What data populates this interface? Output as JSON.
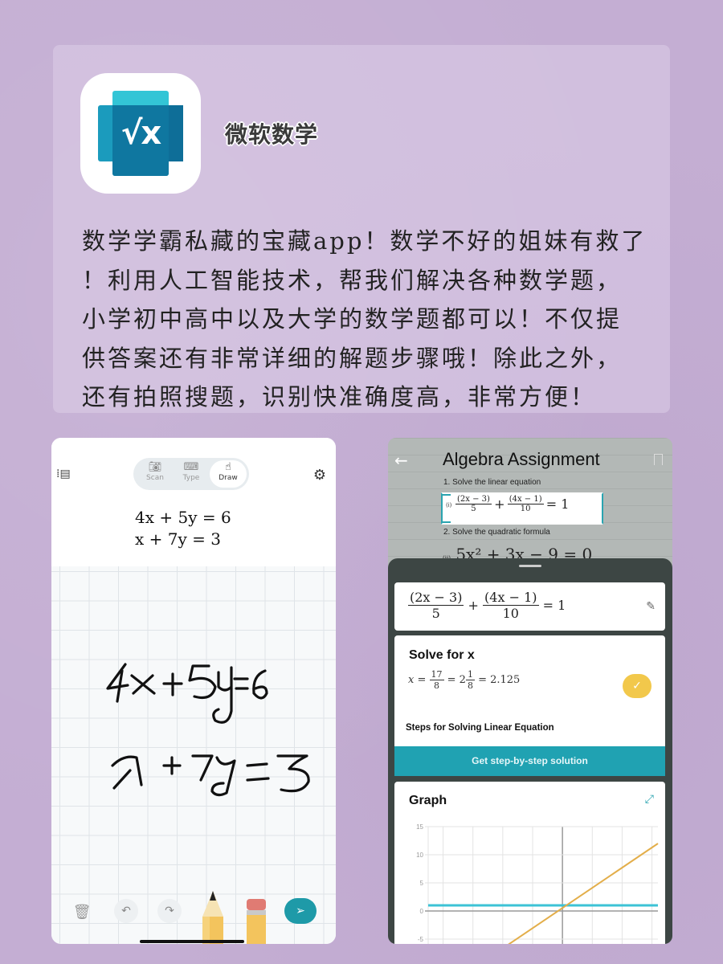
{
  "header": {
    "app_icon_glyph": "√x",
    "app_name": "微软数学",
    "description_lines": [
      "数学学霸私藏的宝藏app！数学不好的姐妹有救了",
      "！利用人工智能技术，帮我们解决各种数学题，",
      "小学初中高中以及大学的数学题都可以！不仅提",
      "供答案还有非常详细的解题步骤哦！除此之外，",
      "还有拍照搜题，识别快准确度高，非常方便！"
    ]
  },
  "left_phone": {
    "menu_icon": "list-icon",
    "settings_icon": "gear-icon",
    "modes": [
      {
        "label": "Scan",
        "icon": "camera-icon",
        "active": false
      },
      {
        "label": "Type",
        "icon": "keyboard-icon",
        "active": false
      },
      {
        "label": "Draw",
        "icon": "hand-draw-icon",
        "active": true
      }
    ],
    "typed_equations": [
      "4x + 5y = 6",
      "x + 7y = 3"
    ],
    "handwritten_equations": [
      "4x+5y=6",
      "x+7y=3"
    ],
    "toolbar": {
      "trash_icon": "trash-icon",
      "undo_icon": "undo-icon",
      "redo_icon": "redo-icon",
      "pencil_tool": "pencil-icon",
      "eraser_tool": "eraser-icon",
      "send_icon": "send-icon"
    }
  },
  "right_phone": {
    "back_icon": "back-arrow-icon",
    "bookmark_icon": "bookmark-icon",
    "paper_title": "Algebra Assignment",
    "question1": "1. Solve the linear equation",
    "question1_label": "(i)",
    "question2": "2. Solve the quadratic formula",
    "question2_label": "(ii)",
    "question2_equation": "5x² + 3x − 9 = 0",
    "equation": {
      "num1": "(2x − 3)",
      "den1": "5",
      "plus": "+",
      "num2": "(4x − 1)",
      "den2": "10",
      "rhs": "= 1"
    },
    "solve": {
      "title": "Solve for x",
      "result_prefix": "x =",
      "result_num": "17",
      "result_den": "8",
      "mixed_whole": "= 2",
      "mixed_num": "1",
      "mixed_den": "8",
      "decimal": "= 2.125",
      "steps_label": "Steps for Solving Linear Equation",
      "step_button": "Get step-by-step solution"
    },
    "graph": {
      "title": "Graph",
      "expand_icon": "expand-icon"
    }
  },
  "chart_data": {
    "type": "line",
    "title": "Graph",
    "xlabel": "",
    "ylabel": "",
    "ylim": [
      -7,
      15
    ],
    "xlim": [
      -4.5,
      3.2
    ],
    "yticks": [
      "15",
      "10",
      "5",
      "0",
      "-5"
    ],
    "ytick_values": [
      15,
      10,
      5,
      0,
      -5
    ],
    "grid": true,
    "series": [
      {
        "name": "y = 1",
        "color": "#3cc3d6",
        "points": [
          [
            -4.5,
            1
          ],
          [
            3.2,
            1
          ]
        ]
      },
      {
        "name": "y = (2x-3)/5 + (4x-1)/10",
        "color": "#e3ae4a",
        "points": [
          [
            -2.1,
            -7
          ],
          [
            3.2,
            12
          ]
        ]
      }
    ]
  }
}
